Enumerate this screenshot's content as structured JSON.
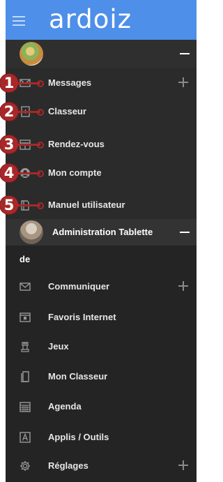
{
  "header": {
    "brand": "ardoiz",
    "menu_icon": "hamburger-icon",
    "color": "#4e8fe9"
  },
  "user_section": {
    "collapse_icon": "minus-icon",
    "items": [
      {
        "label": "Messages",
        "icon": "envelope-icon",
        "badge": "1",
        "has_plus": true
      },
      {
        "label": "Classeur",
        "icon": "binder-icon",
        "badge": "2"
      },
      {
        "label": "Rendez-vous",
        "icon": "calendar-icon",
        "badge": "3"
      },
      {
        "label": "Mon compte",
        "icon": "user-circle-icon",
        "badge": "4"
      },
      {
        "label": "Manuel utilisateur",
        "icon": "book-icon",
        "badge": "5"
      }
    ]
  },
  "admin_section": {
    "name_line1": "Administration Tablette",
    "name_line2": "de",
    "collapse_icon": "minus-icon",
    "items": [
      {
        "label": "Communiquer",
        "icon": "envelope-icon",
        "has_plus": true
      },
      {
        "label": "Favoris Internet",
        "icon": "bookmark-browser-icon"
      },
      {
        "label": "Jeux",
        "icon": "chess-rook-icon"
      },
      {
        "label": "Mon Classeur",
        "icon": "documents-icon"
      },
      {
        "label": "Agenda",
        "icon": "calendar-grid-icon"
      },
      {
        "label": "Applis / Outils",
        "icon": "app-letter-a-icon"
      },
      {
        "label": "Réglages",
        "icon": "gear-icon",
        "has_plus": true
      }
    ]
  },
  "colors": {
    "badge": "#a8282a",
    "panel_bg": "#242424"
  }
}
